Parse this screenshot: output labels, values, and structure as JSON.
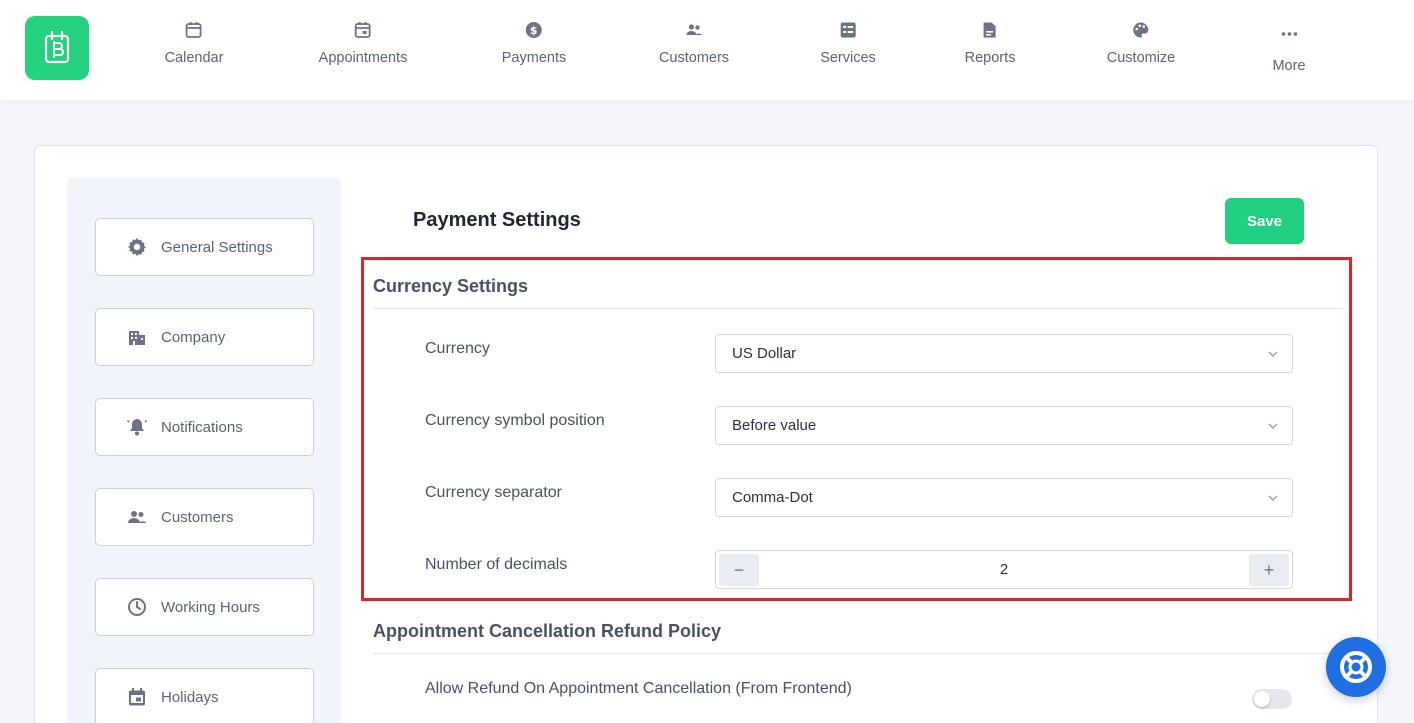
{
  "nav": {
    "items": [
      {
        "label": "Calendar",
        "icon": "calendar-icon"
      },
      {
        "label": "Appointments",
        "icon": "calendar-check-icon"
      },
      {
        "label": "Payments",
        "icon": "dollar-icon"
      },
      {
        "label": "Customers",
        "icon": "users-icon"
      },
      {
        "label": "Services",
        "icon": "list-icon"
      },
      {
        "label": "Reports",
        "icon": "report-icon"
      },
      {
        "label": "Customize",
        "icon": "palette-icon"
      },
      {
        "label": "More",
        "icon": "ellipsis-icon"
      }
    ]
  },
  "sidebar": {
    "items": [
      {
        "label": "General Settings",
        "icon": "gear-icon"
      },
      {
        "label": "Company",
        "icon": "building-icon"
      },
      {
        "label": "Notifications",
        "icon": "bell-icon"
      },
      {
        "label": "Customers",
        "icon": "users-icon"
      },
      {
        "label": "Working Hours",
        "icon": "clock-icon"
      },
      {
        "label": "Holidays",
        "icon": "calendar-icon"
      }
    ]
  },
  "main": {
    "title": "Payment Settings",
    "save_label": "Save",
    "currency_section": {
      "title": "Currency Settings",
      "currency": {
        "label": "Currency",
        "value": "US Dollar"
      },
      "symbol_position": {
        "label": "Currency symbol position",
        "value": "Before value"
      },
      "separator": {
        "label": "Currency separator",
        "value": "Comma-Dot"
      },
      "decimals": {
        "label": "Number of decimals",
        "value": "2",
        "minus": "−",
        "plus": "+"
      }
    },
    "refund_section": {
      "title": "Appointment Cancellation Refund Policy",
      "allow_refund": {
        "label": "Allow Refund On Appointment Cancellation (From Frontend)",
        "enabled": false
      }
    }
  },
  "colors": {
    "brand": "#23d17e",
    "save": "#20cf7f",
    "highlight": "#d9262c",
    "help": "#1f6fe0"
  }
}
